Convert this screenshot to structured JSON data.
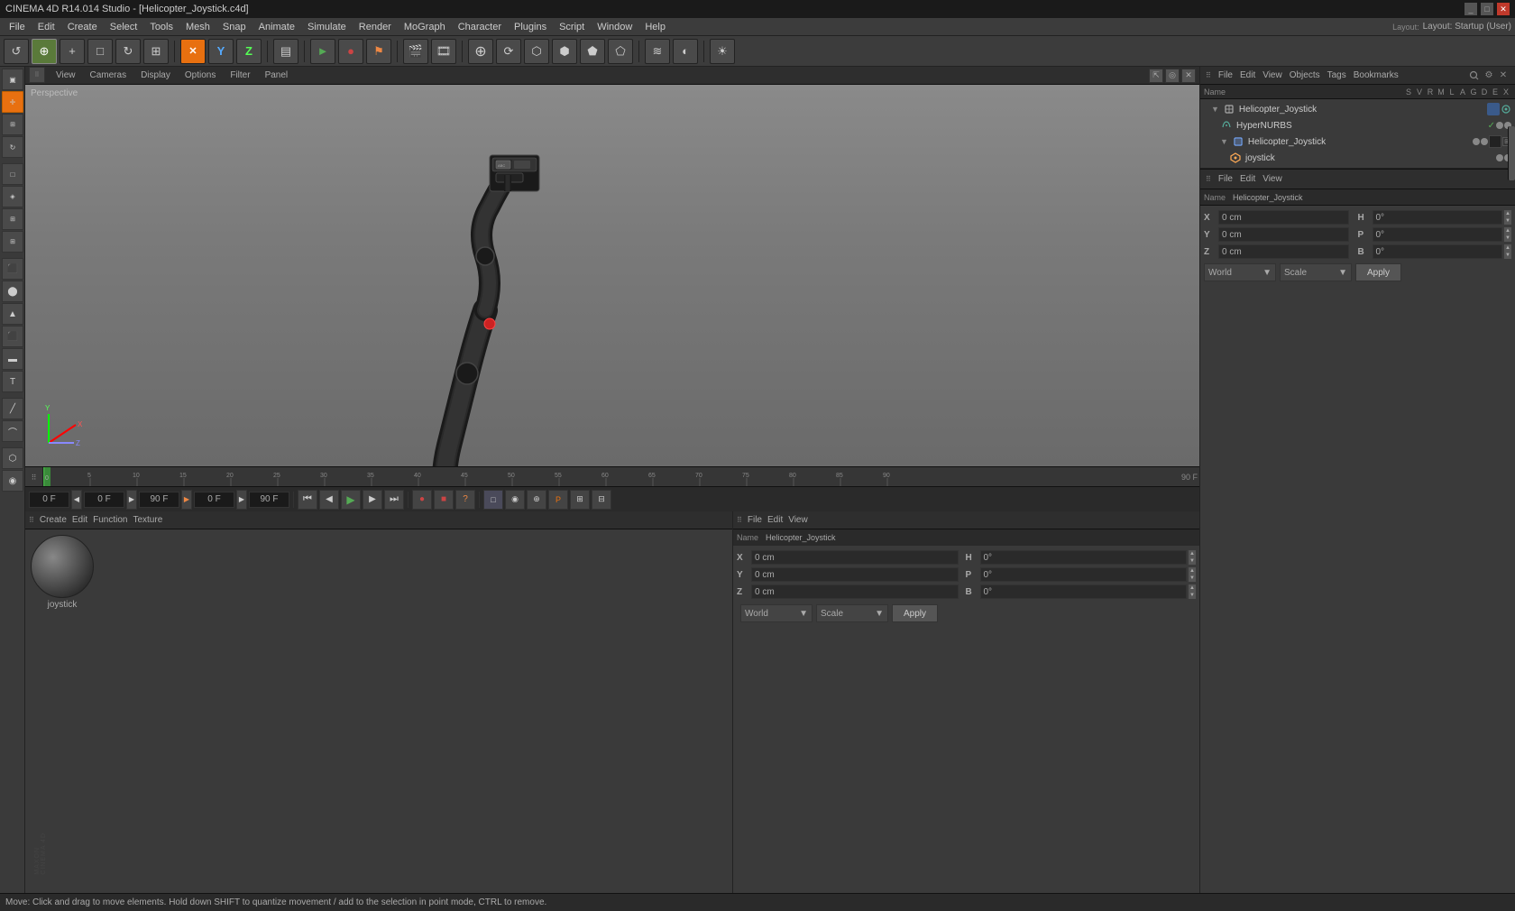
{
  "titleBar": {
    "title": "CINEMA 4D R14.014 Studio - [Helicopter_Joystick.c4d]",
    "controls": [
      "_",
      "□",
      "✕"
    ]
  },
  "menuBar": {
    "items": [
      "File",
      "Edit",
      "Create",
      "Select",
      "Tools",
      "Mesh",
      "Snap",
      "Animate",
      "Simulate",
      "Render",
      "MoGraph",
      "Character",
      "Plugins",
      "Script",
      "Window",
      "Help"
    ]
  },
  "viewportMenu": {
    "items": [
      "View",
      "Cameras",
      "Display",
      "Options",
      "Filter",
      "Panel"
    ]
  },
  "viewportLabel": "Perspective",
  "rightTopMenu": {
    "items": [
      "File",
      "Edit",
      "View",
      "Objects",
      "Tags",
      "Bookmarks"
    ]
  },
  "layoutLabel": "Layout: Startup (User)",
  "objectTree": {
    "items": [
      {
        "name": "Helicopter_Joystick",
        "level": 0,
        "icon": "null",
        "hasArrow": true,
        "expanded": true
      },
      {
        "name": "HyperNURBS",
        "level": 1,
        "icon": "hypernurbs",
        "hasArrow": false,
        "expanded": false
      },
      {
        "name": "Helicopter_Joystick",
        "level": 1,
        "icon": "geo",
        "hasArrow": true,
        "expanded": true
      },
      {
        "name": "joystick",
        "level": 2,
        "icon": "joint",
        "hasArrow": false,
        "expanded": false
      }
    ],
    "columns": [
      "Name",
      "S",
      "V",
      "R",
      "M",
      "L",
      "A",
      "G",
      "D",
      "E",
      "X"
    ]
  },
  "rightLowerMenu": {
    "items": [
      "File",
      "Edit",
      "View"
    ]
  },
  "attributeManager": {
    "nameLabel": "Helicopter_Joystick",
    "coords": {
      "x": {
        "label": "X",
        "val": "0 cm",
        "unit": "H",
        "hval": "0°"
      },
      "y": {
        "label": "Y",
        "val": "0 cm",
        "unit": "P",
        "hval": "0°"
      },
      "z": {
        "label": "Z",
        "val": "0 cm",
        "unit": "B",
        "hval": "0°"
      }
    },
    "dropdowns": {
      "mode": "World",
      "type": "Scale"
    },
    "applyBtn": "Apply"
  },
  "materialPanel": {
    "menus": [
      "Create",
      "Edit",
      "Function",
      "Texture"
    ],
    "material": {
      "name": "joystick"
    }
  },
  "playback": {
    "currentFrame": "0 F",
    "startFrame": "0 F",
    "endFrame": "90 F",
    "currentFrameRight": "90 F",
    "previewStart": "0 F",
    "previewEnd": "90 F"
  },
  "statusBar": {
    "text": "Move: Click and drag to move elements. Hold down SHIFT to quantize movement / add to the selection in point mode, CTRL to remove."
  },
  "timeline": {
    "ticks": [
      0,
      5,
      10,
      15,
      20,
      25,
      30,
      35,
      40,
      45,
      50,
      55,
      60,
      65,
      70,
      75,
      80,
      85,
      90
    ]
  }
}
